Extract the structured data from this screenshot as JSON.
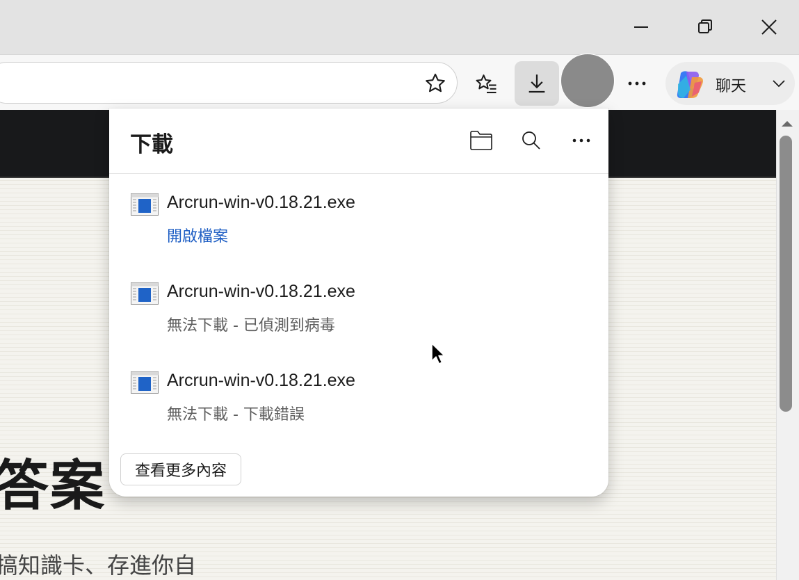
{
  "window": {
    "minimize_icon": "minimize-icon",
    "restore_icon": "restore-icon",
    "close_icon": "close-icon"
  },
  "toolbar": {
    "favorite_icon": "star-icon",
    "favorites_icon": "favorites-list-icon",
    "downloads_icon": "download-icon",
    "more_icon": "more-icon",
    "chat_label": "聊天"
  },
  "downloads": {
    "title": "下載",
    "items": [
      {
        "filename": "Arcrun-win-v0.18.21.exe",
        "status": "開啟檔案"
      },
      {
        "filename": "Arcrun-win-v0.18.21.exe",
        "status": "無法下載 - 已偵測到病毒"
      },
      {
        "filename": "Arcrun-win-v0.18.21.exe",
        "status": "無法下載 - 下載錯誤"
      }
    ],
    "see_more": "查看更多內容",
    "link_color": "#1e5ec4"
  },
  "page": {
    "heading_fragment": "答案",
    "subtext_fragment": "搞知識卡、存進你自"
  }
}
